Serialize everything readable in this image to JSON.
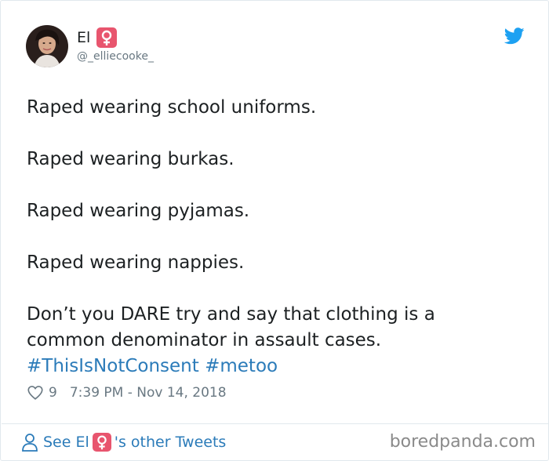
{
  "tweet": {
    "author_name": "El",
    "author_emoji": "female-sign-emoji",
    "handle": "@_elliecooke_",
    "lines": [
      "Raped wearing school uniforms.",
      "Raped wearing burkas.",
      "Raped wearing pyjamas.",
      "Raped wearing nappies.",
      "Don’t you DARE try and say that clothing is a",
      "common denominator in assault cases."
    ],
    "hashtags": [
      "#ThisIsNotConsent",
      "#metoo"
    ],
    "likes": "9",
    "timestamp": "7:39 PM - Nov 14, 2018"
  },
  "footer": {
    "see_prefix": "See El",
    "see_suffix": "'s other Tweets"
  },
  "watermark": "boredpanda.com",
  "colors": {
    "link": "#2b7bb9",
    "twitter_blue": "#1da1f2",
    "emoji_bg": "#e8556e",
    "muted": "#697882"
  }
}
